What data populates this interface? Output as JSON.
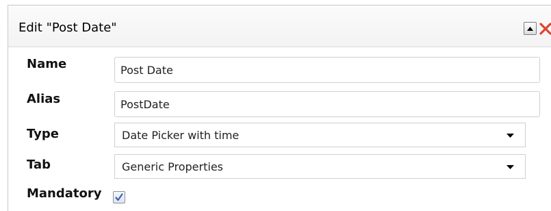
{
  "dialog": {
    "title": "Edit \"Post Date\"",
    "collapse_icon": "chevron-up-icon",
    "close_icon": "close-icon"
  },
  "fields": {
    "name": {
      "label": "Name",
      "value": "Post Date"
    },
    "alias": {
      "label": "Alias",
      "value": "PostDate"
    },
    "type": {
      "label": "Type",
      "selected": "Date Picker with time"
    },
    "tab": {
      "label": "Tab",
      "selected": "Generic Properties"
    },
    "mandatory": {
      "label": "Mandatory",
      "checked": true
    }
  },
  "colors": {
    "close_red": "#e0432f",
    "check_blue": "#3b5fb0"
  }
}
